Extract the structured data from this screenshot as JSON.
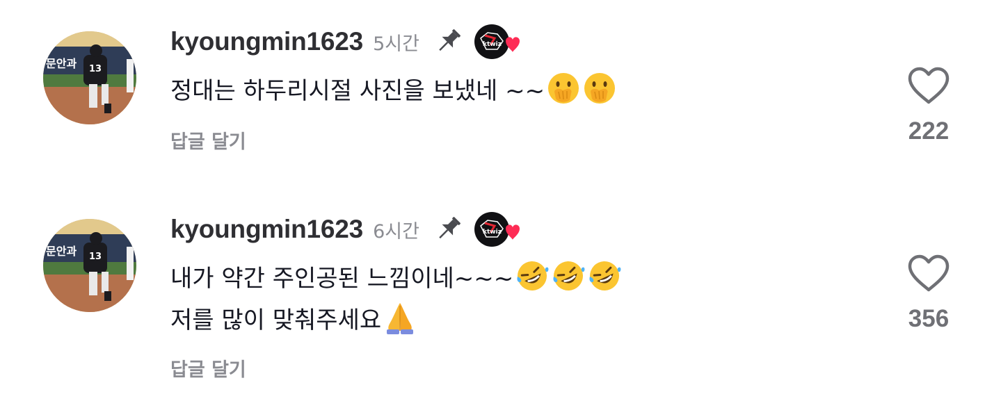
{
  "comments": [
    {
      "username": "kyoungmin1623",
      "time": "5시간",
      "text_lines": [
        "정대는 하두리시절 사진을 보냈네 ~~"
      ],
      "emojis": [
        "face-with-hand-over-mouth-emoji",
        "face-with-hand-over-mouth-emoji"
      ],
      "reply_label": "답글 달기",
      "like_count": "222",
      "pinned": true,
      "badge": "ktwiz-heart-badge"
    },
    {
      "username": "kyoungmin1623",
      "time": "6시간",
      "text_lines": [
        "내가 약간 주인공된 느낌이네~~~",
        "저를 많이 맞춰주세요"
      ],
      "emojis_line1": [
        "rolling-on-the-floor-laughing-emoji",
        "rolling-on-the-floor-laughing-emoji",
        "rolling-on-the-floor-laughing-emoji"
      ],
      "emojis_line2": [
        "folded-hands-emoji"
      ],
      "reply_label": "답글 달기",
      "like_count": "356",
      "pinned": true,
      "badge": "ktwiz-heart-badge"
    }
  ],
  "avatar_logo_text": "ktwiz",
  "colors": {
    "username": "#2f2f33",
    "secondary": "#8a8b91",
    "like_count": "#6f7075",
    "heart_badge": "#fe2c55"
  }
}
